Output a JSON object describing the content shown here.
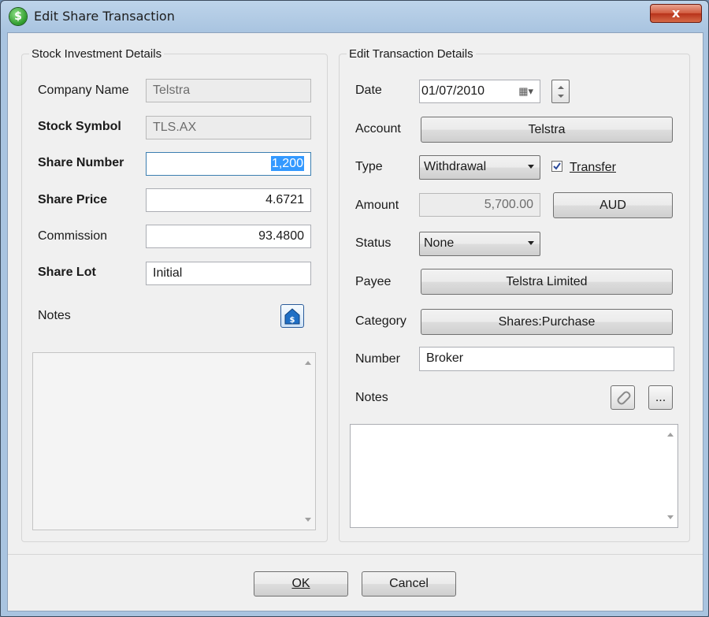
{
  "window": {
    "title": "Edit Share Transaction",
    "close_label": "x",
    "app_icon_glyph": "$"
  },
  "stock": {
    "group_title": "Stock Investment Details",
    "company_name": {
      "label": "Company Name",
      "value": "Telstra"
    },
    "stock_symbol": {
      "label": "Stock Symbol",
      "value": "TLS.AX"
    },
    "share_number": {
      "label": "Share Number",
      "value": "1,200"
    },
    "share_price": {
      "label": "Share Price",
      "value": "4.6721"
    },
    "commission": {
      "label": "Commission",
      "value": "93.4800"
    },
    "share_lot": {
      "label": "Share Lot",
      "value": "Initial"
    },
    "notes": {
      "label": "Notes",
      "icon": "stock-notes-icon"
    }
  },
  "transaction": {
    "group_title": "Edit Transaction Details",
    "date": {
      "label": "Date",
      "value": "01/07/2010"
    },
    "account": {
      "label": "Account",
      "value": "Telstra"
    },
    "type": {
      "label": "Type",
      "value": "Withdrawal",
      "transfer_label": "Transfer",
      "transfer_checked": true
    },
    "amount": {
      "label": "Amount",
      "value": "5,700.00",
      "currency": "AUD"
    },
    "status": {
      "label": "Status",
      "value": "None"
    },
    "payee": {
      "label": "Payee",
      "value": "Telstra Limited"
    },
    "category": {
      "label": "Category",
      "value": "Shares:Purchase"
    },
    "number": {
      "label": "Number",
      "value": "Broker"
    },
    "notes": {
      "label": "Notes",
      "more_label": "..."
    }
  },
  "footer": {
    "ok_label": "OK",
    "cancel_label": "Cancel"
  }
}
